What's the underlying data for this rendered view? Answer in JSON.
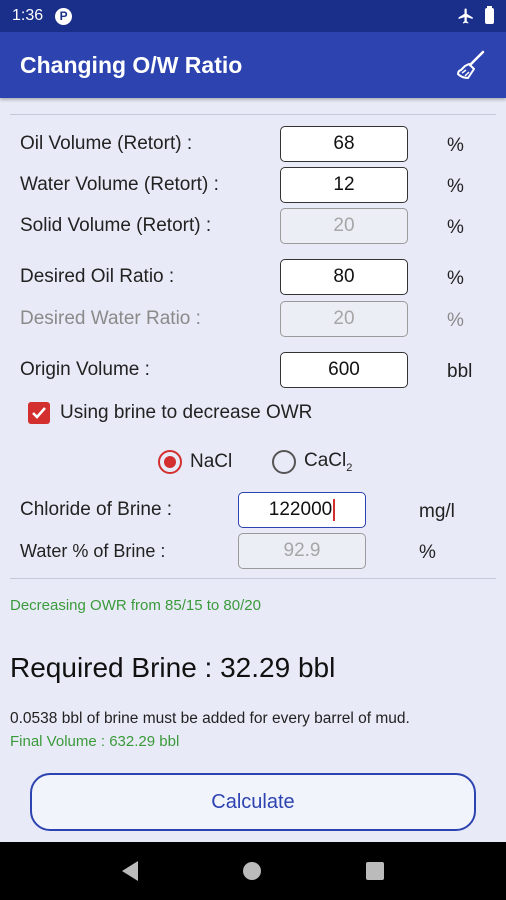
{
  "status": {
    "time": "1:36",
    "notif_glyph": "P",
    "icons": [
      "airplane-icon",
      "battery-icon"
    ]
  },
  "appbar": {
    "title": "Changing O/W Ratio",
    "action_icon": "broom-icon"
  },
  "form": {
    "oil": {
      "label": "Oil Volume (Retort) :",
      "value": "68",
      "unit": "%"
    },
    "water": {
      "label": "Water Volume (Retort) :",
      "value": "12",
      "unit": "%"
    },
    "solid": {
      "label": "Solid Volume (Retort) :",
      "value": "20",
      "unit": "%"
    },
    "desired_oil": {
      "label": "Desired Oil Ratio :",
      "value": "80",
      "unit": "%"
    },
    "desired_water": {
      "label": "Desired Water Ratio :",
      "value": "20",
      "unit": "%"
    },
    "origin": {
      "label": "Origin Volume :",
      "value": "600",
      "unit": "bbl"
    },
    "brine_check": {
      "label": "Using brine to decrease OWR",
      "checked": true
    },
    "salt": {
      "nacl": "NaCl",
      "cacl_base": "CaCl",
      "cacl_sub": "2",
      "selected": "NaCl"
    },
    "chloride": {
      "label": "Chloride of Brine :",
      "value": "122000",
      "unit": "mg/l"
    },
    "water_pct": {
      "label": "Water % of Brine :",
      "value": "92.9",
      "unit": "%"
    }
  },
  "results": {
    "owr_msg": "Decreasing OWR from 85/15 to 80/20",
    "required": "Required Brine : 32.29 bbl",
    "per_barrel": "0.0538 bbl of brine must be added for every barrel of mud.",
    "final_volume": "Final Volume : 632.29 bbl"
  },
  "calculate_label": "Calculate",
  "colors": {
    "appbar": "#2d43b0",
    "statusbar": "#1a2f8a",
    "accent": "#d32f2f",
    "success": "#3a9a3a",
    "background": "#e8ebf7"
  },
  "navbar": {
    "icons": [
      "back-icon",
      "home-icon",
      "recents-icon"
    ]
  }
}
